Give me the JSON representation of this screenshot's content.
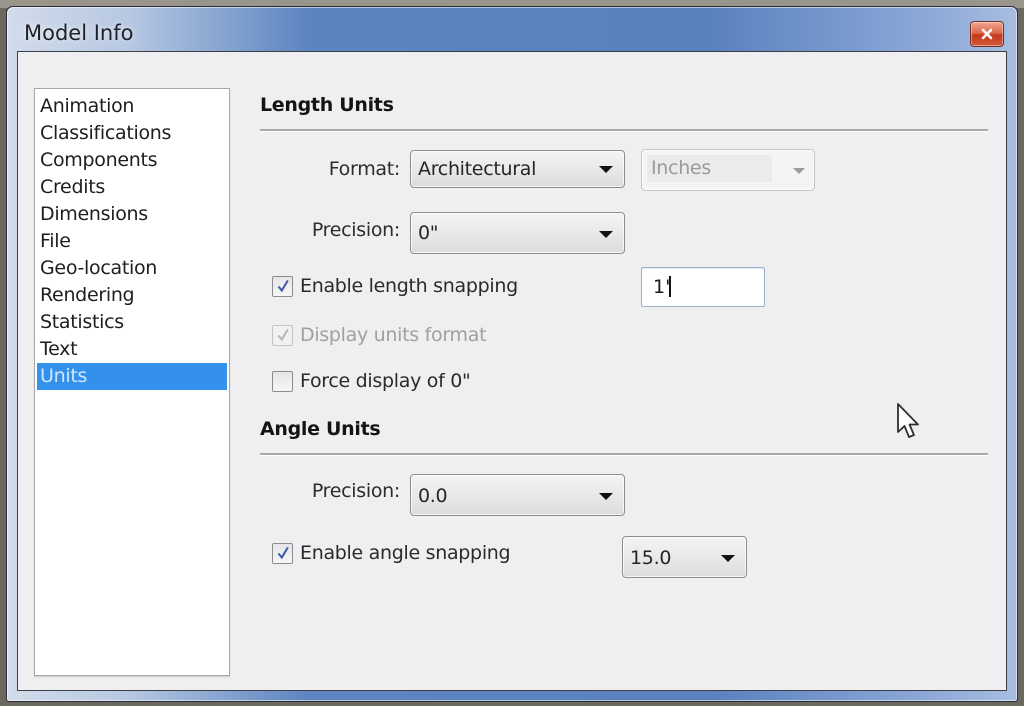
{
  "window": {
    "title": "Model Info",
    "close_icon": "close-x-icon"
  },
  "sidebar": {
    "items": [
      {
        "label": "Animation",
        "selected": false
      },
      {
        "label": "Classifications",
        "selected": false
      },
      {
        "label": "Components",
        "selected": false
      },
      {
        "label": "Credits",
        "selected": false
      },
      {
        "label": "Dimensions",
        "selected": false
      },
      {
        "label": "File",
        "selected": false
      },
      {
        "label": "Geo-location",
        "selected": false
      },
      {
        "label": "Rendering",
        "selected": false
      },
      {
        "label": "Statistics",
        "selected": false
      },
      {
        "label": "Text",
        "selected": false
      },
      {
        "label": "Units",
        "selected": true
      }
    ],
    "selected_color": "#3391ec"
  },
  "length_units": {
    "title": "Length Units",
    "format": {
      "label": "Format:",
      "value": "Architectural"
    },
    "unit": {
      "value": "Inches",
      "enabled": false
    },
    "precision": {
      "label": "Precision:",
      "value": "0\""
    },
    "enable_snapping": {
      "label": "Enable length snapping",
      "checked": true,
      "enabled": true
    },
    "snap_value": "1'",
    "display_units_format": {
      "label": "Display units format",
      "checked": true,
      "enabled": false
    },
    "force_display_zero": {
      "label": "Force display of 0\"",
      "checked": false,
      "enabled": true
    }
  },
  "angle_units": {
    "title": "Angle Units",
    "precision": {
      "label": "Precision:",
      "value": "0.0"
    },
    "enable_snapping": {
      "label": "Enable angle snapping",
      "checked": true,
      "enabled": true
    },
    "snap_value": "15.0"
  },
  "mouse_cursor": "arrow-pointer-icon"
}
